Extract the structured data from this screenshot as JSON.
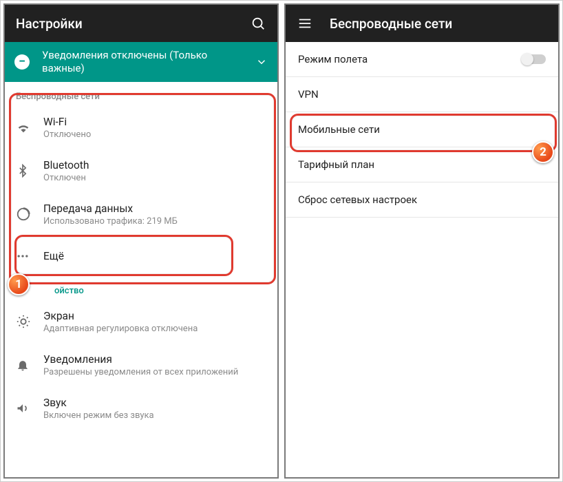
{
  "left": {
    "appbar_title": "Настройки",
    "banner_text": "Уведомления отключены (Только важные)",
    "section_wireless": "Беспроводные сети",
    "wifi": {
      "label": "Wi-Fi",
      "sub": "Отключено"
    },
    "bt": {
      "label": "Bluetooth",
      "sub": "Отключен"
    },
    "data": {
      "label": "Передача данных",
      "sub": "Использовано трафика: 219 МБ"
    },
    "more": {
      "label": "Ещё"
    },
    "section_device_partial": "ойство",
    "display": {
      "label": "Экран",
      "sub": "Адаптивная регулировка отключена"
    },
    "notif": {
      "label": "Уведомления",
      "sub": "Разрешены уведомления от всех приложений"
    },
    "sound": {
      "label": "Звук",
      "sub": "Включен режим без звука"
    }
  },
  "right": {
    "appbar_title": "Беспроводные сети",
    "airplane": "Режим полета",
    "vpn": "VPN",
    "mobile": "Мобильные сети",
    "tariff": "Тарифный план",
    "reset": "Сброс сетевых настроек"
  },
  "steps": {
    "one": "1",
    "two": "2"
  }
}
